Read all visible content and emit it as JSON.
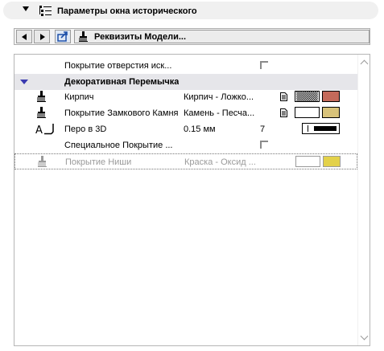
{
  "panel": {
    "title": "Параметры окна исторического"
  },
  "toolbar": {
    "model_attributes_label": "Реквизиты Модели..."
  },
  "rows": [
    {
      "name": "Покрытие отверстия иск...",
      "value": ""
    },
    {
      "name": "Декоративная Перемычка"
    },
    {
      "name": "Кирпич",
      "value": "Кирпич - Ложко..."
    },
    {
      "name": "Покрытие Замкового Камня",
      "value": "Камень - Песча..."
    },
    {
      "name": "Перо в 3D",
      "value": "0.15 мм",
      "extra": "7"
    },
    {
      "name": "Специальное Покрытие ...",
      "value": ""
    },
    {
      "name": "Покрытие Ниши",
      "value": "Краска - Оксид ..."
    }
  ],
  "colors": {
    "brick_swatch": "#c46a5a",
    "keystone_swatch": "#d8c27a",
    "niche_swatch": "#e3d14a",
    "group_row_bg": "#e6e6ea"
  },
  "icons": {
    "panel": "tree-list-icon",
    "prev": "arrow-left-icon",
    "next": "arrow-right-icon",
    "export": "export-icon",
    "model": "brush-icon",
    "pen": "pen-icon"
  }
}
